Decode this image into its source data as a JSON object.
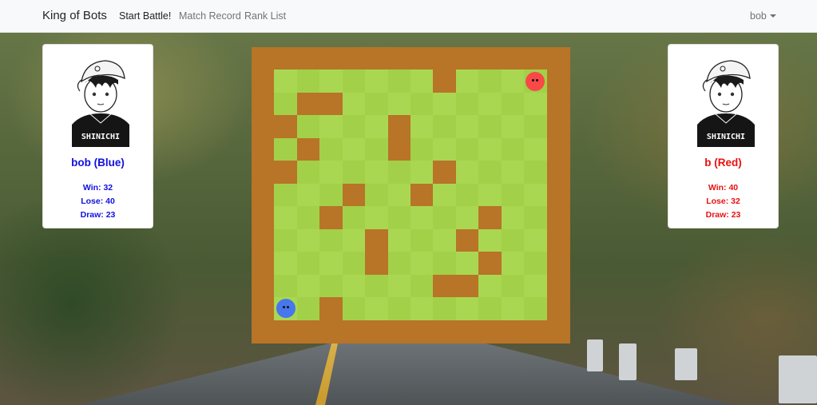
{
  "navbar": {
    "brand": "King of Bots",
    "links": [
      {
        "label": "Start Battle!",
        "active": true
      },
      {
        "label": "Match Record",
        "active": false
      },
      {
        "label": "Rank List",
        "active": false
      }
    ],
    "user": "bob"
  },
  "players": {
    "left": {
      "name": "bob (Blue)",
      "win": "Win: 32",
      "lose": "Lose: 40",
      "draw": "Draw: 23",
      "color": "#1010e0"
    },
    "right": {
      "name": "b (Red)",
      "win": "Win: 40",
      "lose": "Lose: 32",
      "draw": "Draw: 23",
      "color": "#e81010"
    }
  },
  "avatar_shirt_text": "SHINICHI",
  "game": {
    "rows": 13,
    "cols": 14,
    "wall_color": "#b87427",
    "grass_light": "#aad751",
    "grass_dark": "#a2d149",
    "walls": [
      [
        8,
        1
      ],
      [
        9,
        1
      ],
      [
        10,
        1
      ],
      [
        11,
        1
      ],
      [
        12,
        1
      ],
      [
        13,
        1
      ],
      [
        14,
        1
      ],
      [
        15,
        1
      ],
      [
        8,
        2
      ],
      [
        9,
        2
      ],
      [
        10,
        2
      ],
      [
        11,
        2
      ],
      [
        12,
        2
      ],
      [
        13,
        2
      ],
      [
        14,
        2
      ],
      [
        15,
        2
      ]
    ],
    "blue_snake": {
      "row": 11,
      "col": 1,
      "color": "#4876ec"
    },
    "red_snake": {
      "row": 1,
      "col": 12,
      "color": "#f94848"
    }
  }
}
